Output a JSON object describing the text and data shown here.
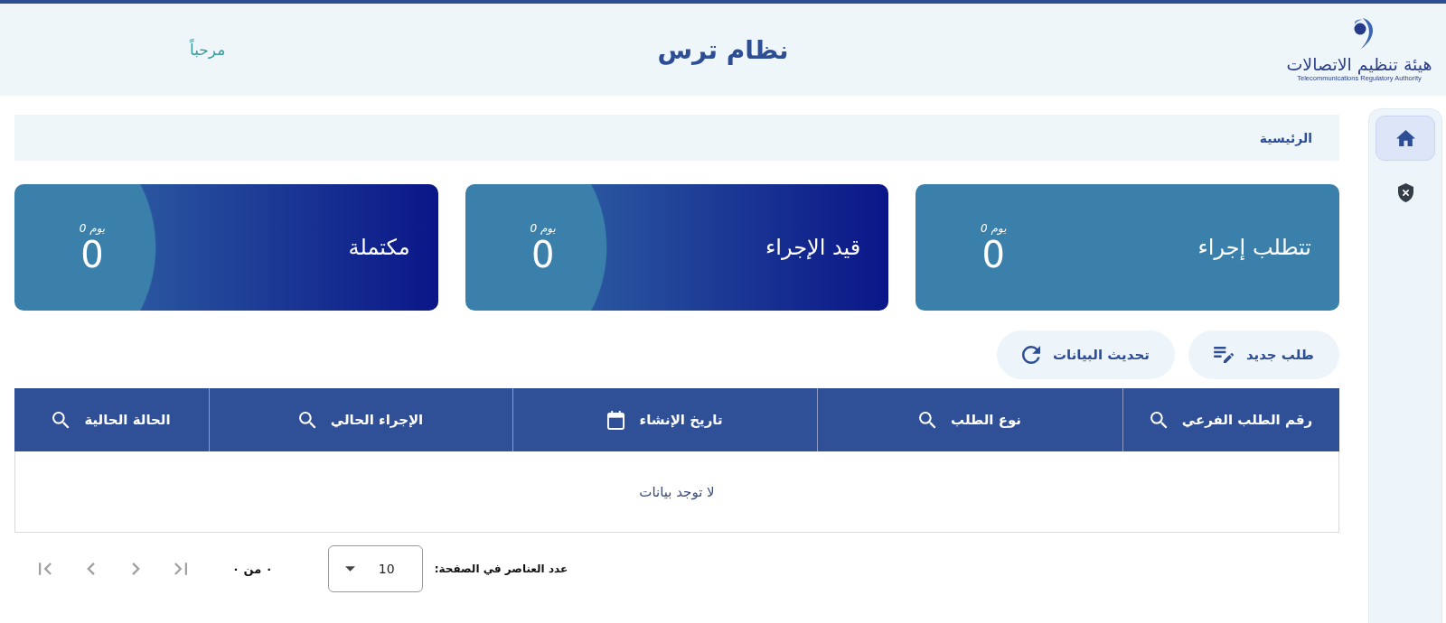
{
  "header": {
    "logo": {
      "arabic_name": "هيئة تنظيم الاتصالات",
      "english_name": "Telecommunications Regulatory Authority"
    },
    "title": "نظام ترس",
    "greeting": "مرحباً"
  },
  "sidebar": {
    "items": [
      {
        "kind": "home",
        "selected": true
      },
      {
        "kind": "blocked",
        "selected": false
      }
    ]
  },
  "breadcrumb": {
    "items": [
      {
        "label": "الرئيسية"
      }
    ]
  },
  "summary_cards": [
    {
      "kind": "solid",
      "title": "تتطلب إجراء",
      "days": "يوم 0",
      "count": "0"
    },
    {
      "kind": "gradient",
      "title": "قيد الإجراء",
      "days": "يوم 0",
      "count": "0"
    },
    {
      "kind": "gradient",
      "title": "مكتملة",
      "days": "يوم 0",
      "count": "0"
    }
  ],
  "actions": [
    {
      "kind": "new",
      "label": "طلب جديد"
    },
    {
      "kind": "refresh",
      "label": "تحديث البيانات"
    }
  ],
  "table": {
    "columns": [
      {
        "label": "رقم الطلب الفرعي",
        "kind": "text"
      },
      {
        "label": "نوع الطلب",
        "kind": "text"
      },
      {
        "label": "تاريخ الإنشاء",
        "kind": "date"
      },
      {
        "label": "الإجراء الحالي",
        "kind": "text"
      },
      {
        "label": "الحالة الحالية",
        "kind": "text"
      }
    ],
    "empty_message": "لا توجد بيانات"
  },
  "pagination": {
    "page_size_label": "عدد العناصر في الصفحة:",
    "page_size": "10",
    "range": "٠ من ٠",
    "buttons": [
      {
        "kind": "first",
        "disabled": true
      },
      {
        "kind": "previous",
        "disabled": true
      },
      {
        "kind": "next",
        "disabled": true
      },
      {
        "kind": "last",
        "disabled": true
      }
    ]
  }
}
